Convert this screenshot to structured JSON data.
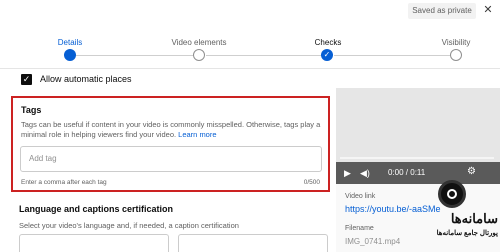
{
  "header": {
    "saved_label": "Saved as private",
    "close_icon": "close-icon"
  },
  "steps": [
    {
      "label": "Details",
      "state": "active"
    },
    {
      "label": "Video elements",
      "state": "pending"
    },
    {
      "label": "Checks",
      "state": "current"
    },
    {
      "label": "Visibility",
      "state": "pending"
    }
  ],
  "allow_places": {
    "label": "Allow automatic places",
    "checked": true
  },
  "tags": {
    "title": "Tags",
    "description": "Tags can be useful if content in your video is commonly misspelled. Otherwise, tags play a minimal role in helping viewers find your video.",
    "learn_more": "Learn more",
    "placeholder": "Add tag",
    "hint": "Enter a comma after each tag",
    "count": "0/500"
  },
  "language": {
    "title": "Language and captions certification",
    "description": "Select your video's language and, if needed, a caption certification"
  },
  "player": {
    "time": "0:00 / 0:11",
    "progress": 0
  },
  "video_link": {
    "label": "Video link",
    "url": "https://youtu.be/-aaSMe"
  },
  "filename": {
    "label": "Filename",
    "value": "IMG_0741.mp4"
  },
  "watermark": {
    "title": "سامانه‌ها",
    "subtitle": "پورتال جامع سامانه‌ها"
  },
  "colors": {
    "accent": "#065fd4",
    "highlight_border": "#cc2222"
  }
}
